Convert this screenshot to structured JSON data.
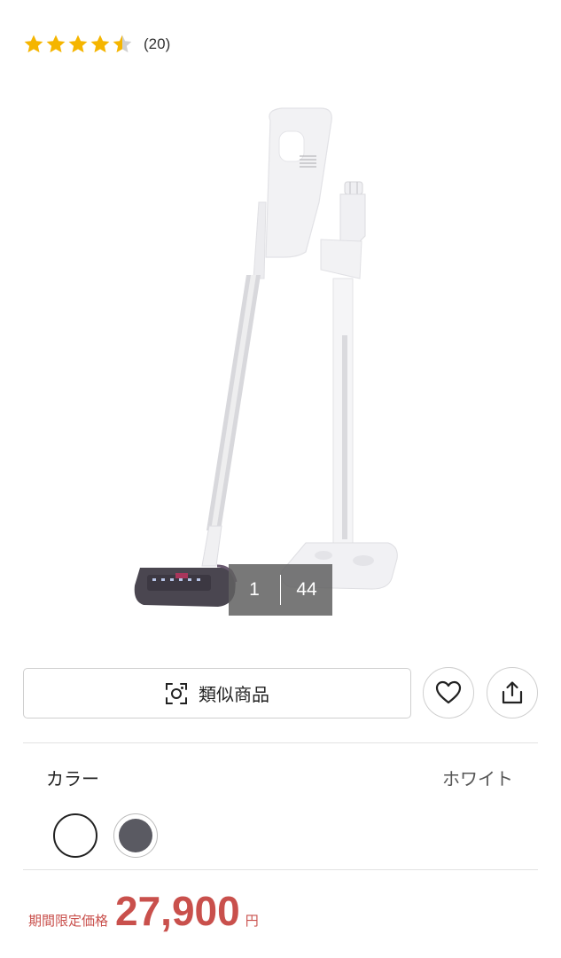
{
  "rating": {
    "value": 4.5,
    "max": 5,
    "count_text": "(20)",
    "star_color": "#F5B500",
    "empty_color": "#D0D0D0"
  },
  "gallery": {
    "current": "1",
    "total": "44"
  },
  "actions": {
    "similar_label": "類似商品",
    "favorite_icon": "heart-icon",
    "share_icon": "share-icon"
  },
  "color_option": {
    "label": "カラー",
    "selected": "ホワイト",
    "swatches": [
      {
        "name": "white",
        "hex": "#FFFFFF"
      },
      {
        "name": "gray",
        "hex": "#5A5A62"
      }
    ]
  },
  "price": {
    "label": "期間限定価格",
    "value": "27,900",
    "unit": "円",
    "color": "#C9504C"
  }
}
